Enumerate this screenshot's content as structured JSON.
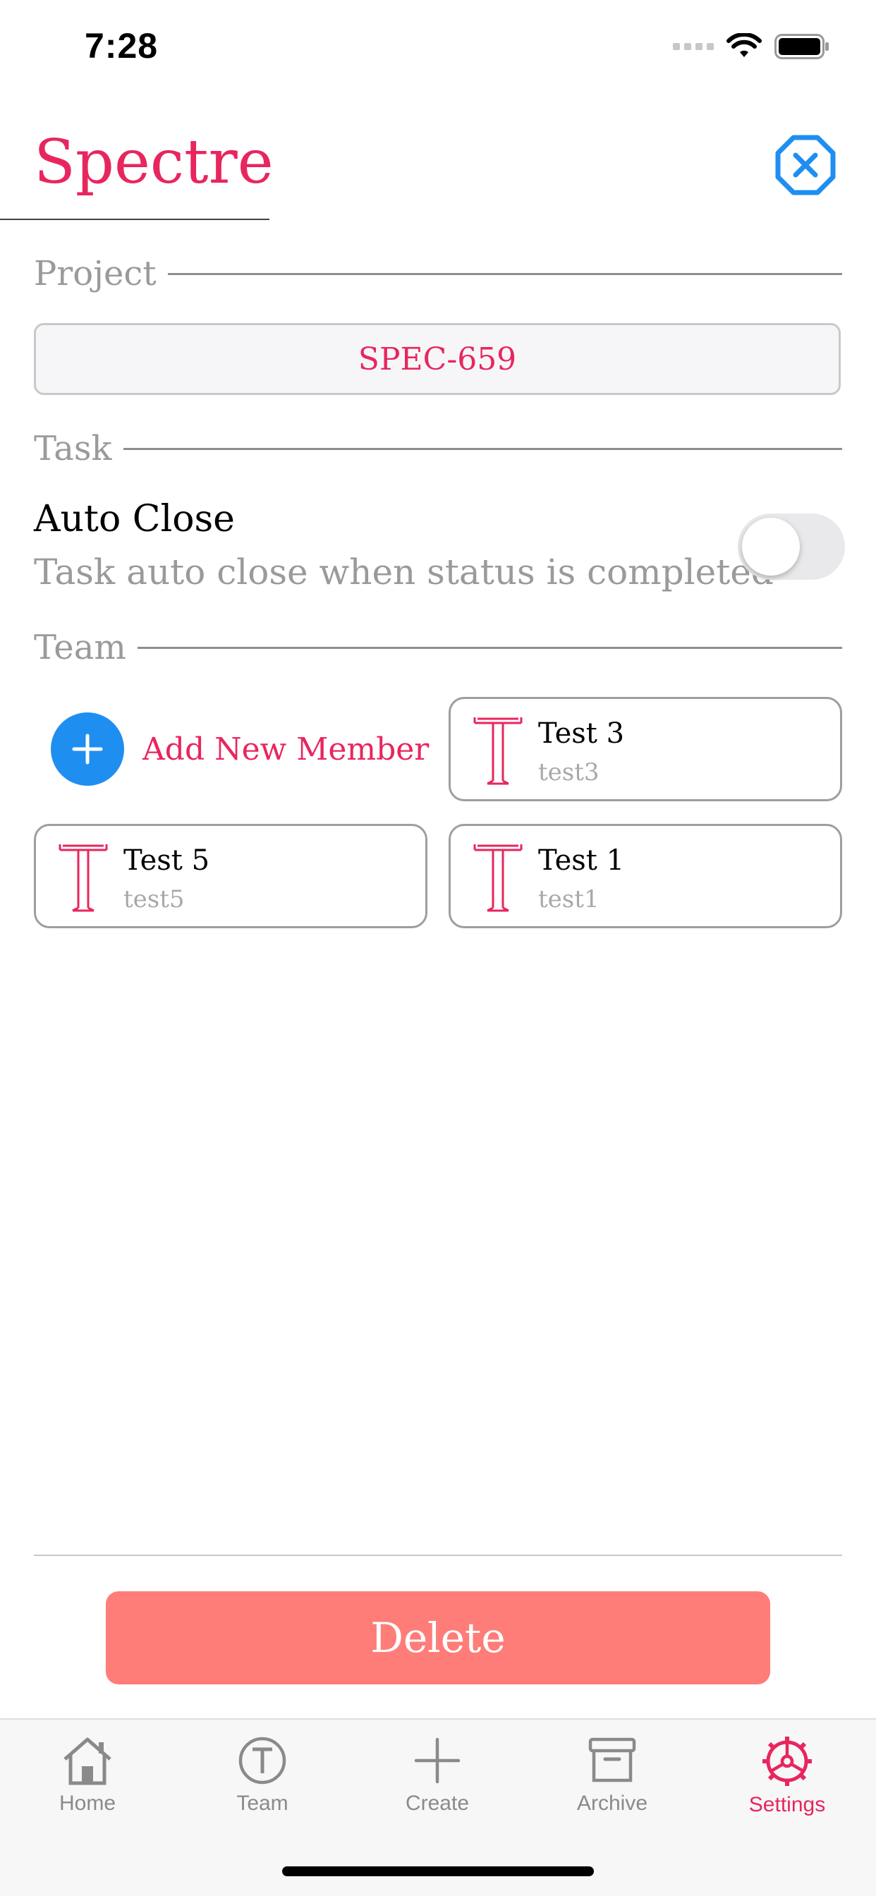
{
  "status_bar": {
    "time": "7:28",
    "icons": [
      "signal-dots-icon",
      "wifi-icon",
      "battery-icon"
    ]
  },
  "header": {
    "title": "Spectre",
    "close_icon": "close-icon"
  },
  "sections": {
    "project": "Project",
    "task": "Task",
    "team": "Team"
  },
  "project": {
    "value": "SPEC-659"
  },
  "task": {
    "auto_close_title": "Auto Close",
    "auto_close_description": "Task auto close when status is completed",
    "auto_close_on": false
  },
  "team": {
    "add_member_label": "Add New Member",
    "members": [
      {
        "name": "Test 3",
        "username": "test3"
      },
      {
        "name": "Test 5",
        "username": "test5"
      },
      {
        "name": "Test 1",
        "username": "test1"
      }
    ]
  },
  "actions": {
    "delete_label": "Delete"
  },
  "tab_bar": {
    "tabs": [
      {
        "label": "Home",
        "icon": "home-icon"
      },
      {
        "label": "Team",
        "icon": "team-icon"
      },
      {
        "label": "Create",
        "icon": "plus-icon"
      },
      {
        "label": "Archive",
        "icon": "archive-icon"
      },
      {
        "label": "Settings",
        "icon": "settings-icon"
      }
    ],
    "active": "Settings"
  },
  "colors": {
    "accent": "#e8265e",
    "blue": "#1f8ef1",
    "delete": "#fe7d79",
    "muted": "#9a9a9a"
  }
}
